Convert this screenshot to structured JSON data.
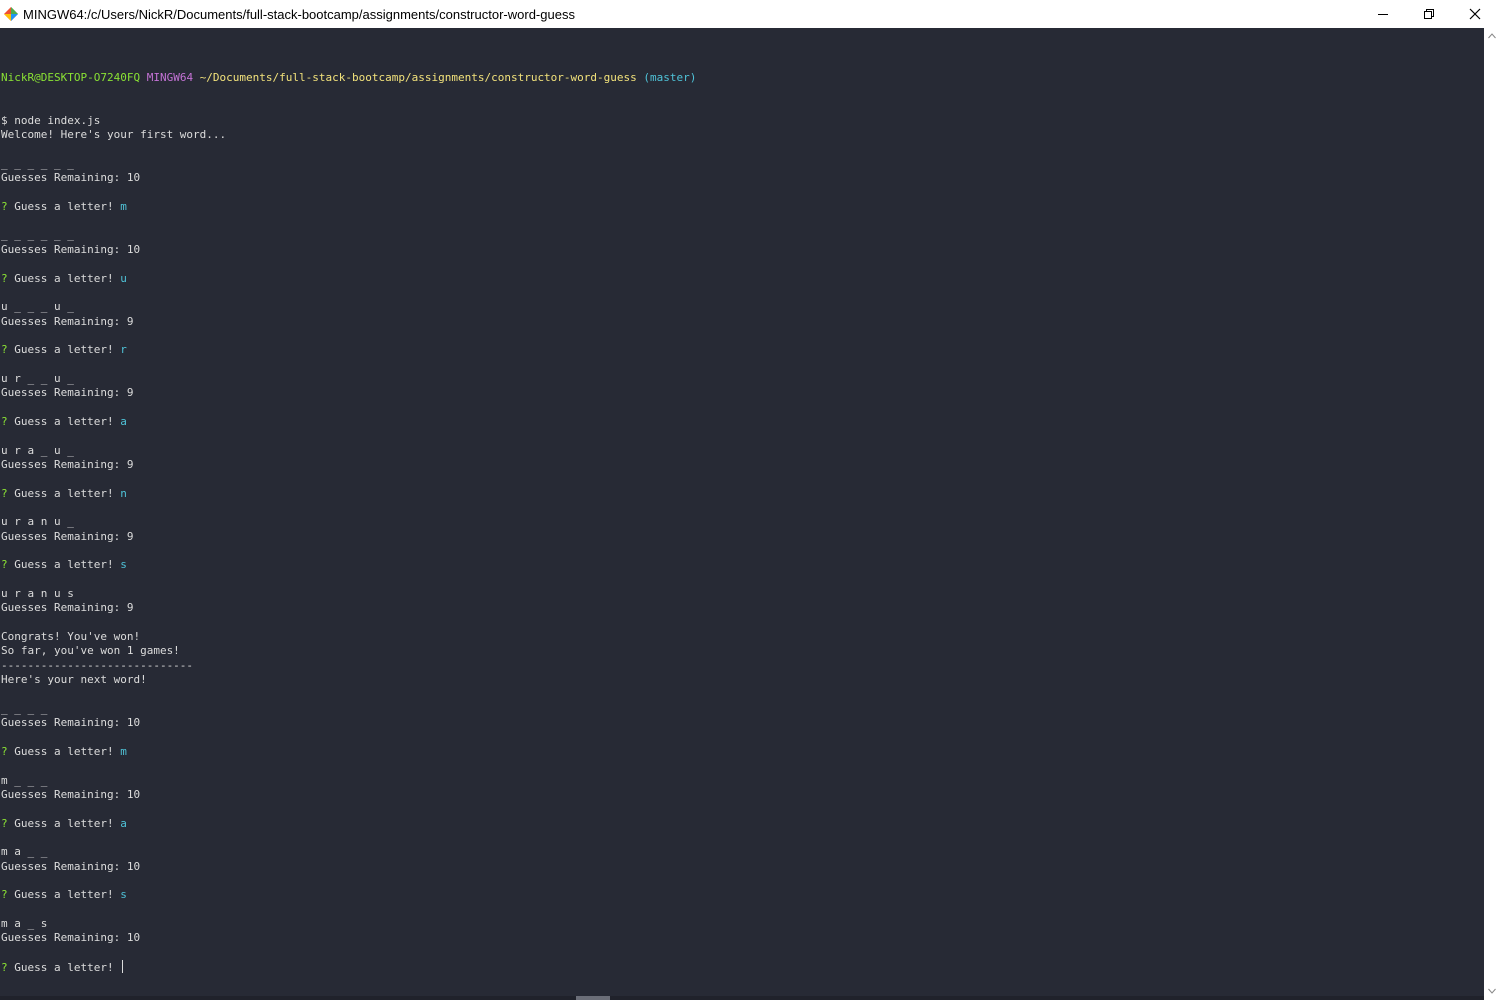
{
  "window": {
    "title": "MINGW64:/c/Users/NickR/Documents/full-stack-bootcamp/assignments/constructor-word-guess",
    "icons": {
      "app": "git-bash-diamond-icon",
      "minimize": "minimize-icon",
      "maximize": "restore-icon",
      "close": "close-icon"
    }
  },
  "terminal": {
    "prompt": {
      "user": "NickR@DESKTOP-O7240FQ",
      "system": "MINGW64",
      "path": "~/Documents/full-stack-bootcamp/assignments/constructor-word-guess",
      "branch": "(master)"
    },
    "lines": [
      {
        "type": "command",
        "text": "$ node index.js"
      },
      {
        "type": "output",
        "text": "Welcome! Here's your first word..."
      },
      {
        "type": "blank",
        "text": ""
      },
      {
        "type": "output",
        "text": "_ _ _ _ _ _"
      },
      {
        "type": "output",
        "text": "Guesses Remaining: 10"
      },
      {
        "type": "blank",
        "text": ""
      },
      {
        "type": "question",
        "label": "Guess a letter!",
        "answer": "m"
      },
      {
        "type": "blank",
        "text": ""
      },
      {
        "type": "output",
        "text": "_ _ _ _ _ _"
      },
      {
        "type": "output",
        "text": "Guesses Remaining: 10"
      },
      {
        "type": "blank",
        "text": ""
      },
      {
        "type": "question",
        "label": "Guess a letter!",
        "answer": "u"
      },
      {
        "type": "blank",
        "text": ""
      },
      {
        "type": "output",
        "text": "u _ _ _ u _"
      },
      {
        "type": "output",
        "text": "Guesses Remaining: 9"
      },
      {
        "type": "blank",
        "text": ""
      },
      {
        "type": "question",
        "label": "Guess a letter!",
        "answer": "r"
      },
      {
        "type": "blank",
        "text": ""
      },
      {
        "type": "output",
        "text": "u r _ _ u _"
      },
      {
        "type": "output",
        "text": "Guesses Remaining: 9"
      },
      {
        "type": "blank",
        "text": ""
      },
      {
        "type": "question",
        "label": "Guess a letter!",
        "answer": "a"
      },
      {
        "type": "blank",
        "text": ""
      },
      {
        "type": "output",
        "text": "u r a _ u _"
      },
      {
        "type": "output",
        "text": "Guesses Remaining: 9"
      },
      {
        "type": "blank",
        "text": ""
      },
      {
        "type": "question",
        "label": "Guess a letter!",
        "answer": "n"
      },
      {
        "type": "blank",
        "text": ""
      },
      {
        "type": "output",
        "text": "u r a n u _"
      },
      {
        "type": "output",
        "text": "Guesses Remaining: 9"
      },
      {
        "type": "blank",
        "text": ""
      },
      {
        "type": "question",
        "label": "Guess a letter!",
        "answer": "s"
      },
      {
        "type": "blank",
        "text": ""
      },
      {
        "type": "output",
        "text": "u r a n u s"
      },
      {
        "type": "output",
        "text": "Guesses Remaining: 9"
      },
      {
        "type": "blank",
        "text": ""
      },
      {
        "type": "output",
        "text": "Congrats! You've won!"
      },
      {
        "type": "output",
        "text": "So far, you've won 1 games!"
      },
      {
        "type": "output",
        "text": "-----------------------------"
      },
      {
        "type": "output",
        "text": "Here's your next word!"
      },
      {
        "type": "blank",
        "text": ""
      },
      {
        "type": "output",
        "text": "_ _ _ _"
      },
      {
        "type": "output",
        "text": "Guesses Remaining: 10"
      },
      {
        "type": "blank",
        "text": ""
      },
      {
        "type": "question",
        "label": "Guess a letter!",
        "answer": "m"
      },
      {
        "type": "blank",
        "text": ""
      },
      {
        "type": "output",
        "text": "m _ _ _"
      },
      {
        "type": "output",
        "text": "Guesses Remaining: 10"
      },
      {
        "type": "blank",
        "text": ""
      },
      {
        "type": "question",
        "label": "Guess a letter!",
        "answer": "a"
      },
      {
        "type": "blank",
        "text": ""
      },
      {
        "type": "output",
        "text": "m a _ _"
      },
      {
        "type": "output",
        "text": "Guesses Remaining: 10"
      },
      {
        "type": "blank",
        "text": ""
      },
      {
        "type": "question",
        "label": "Guess a letter!",
        "answer": "s"
      },
      {
        "type": "blank",
        "text": ""
      },
      {
        "type": "output",
        "text": "m a _ s"
      },
      {
        "type": "output",
        "text": "Guesses Remaining: 10"
      },
      {
        "type": "blank",
        "text": ""
      },
      {
        "type": "question",
        "label": "Guess a letter!",
        "answer": "",
        "active": true
      }
    ],
    "question_mark": "?"
  },
  "colors": {
    "background": "#272a35",
    "text": "#dcdcdc",
    "user": "#8ae234",
    "system": "#c573d6",
    "path": "#f2e27b",
    "branch": "#4fc3d8"
  }
}
